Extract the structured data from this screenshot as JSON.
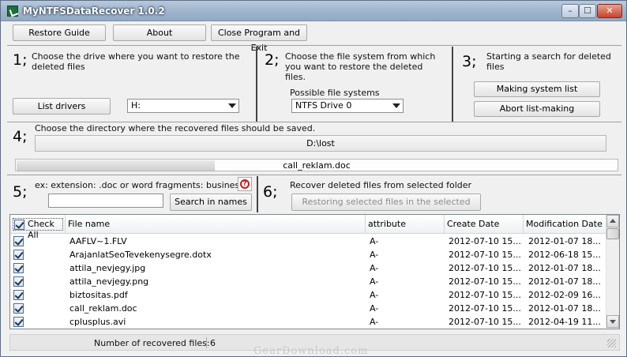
{
  "window": {
    "title": "MyNTFSDataRecover 1.0.2",
    "min_glyph": "–",
    "max_glyph": "☐",
    "close_glyph": "✕",
    "icon": "app-icon"
  },
  "toolbar": {
    "restore_guide": "Restore Guide",
    "about": "About",
    "close_exit": "Close Program and Exit"
  },
  "step1": {
    "number": "1;",
    "text": "Choose the drive where you want to restore the deleted files",
    "list_drivers": "List drivers",
    "drive_value": "H:"
  },
  "step2": {
    "number": "2;",
    "text": "Choose the file system from which you want to restore the deleted files.",
    "label": "Possible file systems",
    "fs_value": "NTFS Drive 0"
  },
  "step3": {
    "number": "3;",
    "text": "Starting a search for deleted files",
    "making_list": "Making system list",
    "abort_list": "Abort list-making"
  },
  "step4": {
    "number": "4;",
    "text": "Choose the directory where the recovered files should be saved.",
    "directory": "D:\\lost"
  },
  "progress": {
    "label": "call_reklam.doc",
    "value": 0.33
  },
  "step5": {
    "number": "5;",
    "text": "ex: extension: .doc or word fragments: business",
    "search_value": "",
    "search_button": "Search in names",
    "help_icon_glyph": "?",
    "help_icon": "help-icon"
  },
  "step6": {
    "number": "6;",
    "text": "Recover deleted files from selected folder",
    "restore_button": "Restoring selected files in the selected directory"
  },
  "table": {
    "headers": {
      "check_all": "Check All",
      "file_name": "File name",
      "attribute": "attribute",
      "create_date": "Create Date",
      "modification_date": "Modification Date"
    },
    "rows": [
      {
        "checked": true,
        "name": "AAFLV~1.FLV",
        "attribute": "A-",
        "create": "2012-07-10   15...",
        "modified": "2012-01-07   18..."
      },
      {
        "checked": true,
        "name": "ArajanlatSeoTevekenysegre.dotx",
        "attribute": "A-",
        "create": "2012-07-10   15...",
        "modified": "2012-06-18   15..."
      },
      {
        "checked": true,
        "name": "attila_nevjegy.jpg",
        "attribute": "A-",
        "create": "2012-07-10   15...",
        "modified": "2012-01-07   18..."
      },
      {
        "checked": true,
        "name": "attila_nevjegy.png",
        "attribute": "A-",
        "create": "2012-07-10   15...",
        "modified": "2012-01-07   18..."
      },
      {
        "checked": true,
        "name": "biztositas.pdf",
        "attribute": "A-",
        "create": "2012-07-10   15...",
        "modified": "2012-02-09   16..."
      },
      {
        "checked": true,
        "name": "call_reklam.doc",
        "attribute": "A-",
        "create": "2012-07-10   15...",
        "modified": "2012-01-07   18..."
      },
      {
        "checked": true,
        "name": "cplusplus.avi",
        "attribute": "A-",
        "create": "2012-07-10   15...",
        "modified": "2012-04-19   11..."
      }
    ]
  },
  "status": {
    "label": "Number of recovered files:",
    "count": "6"
  },
  "watermark": "GearDownload.com"
}
